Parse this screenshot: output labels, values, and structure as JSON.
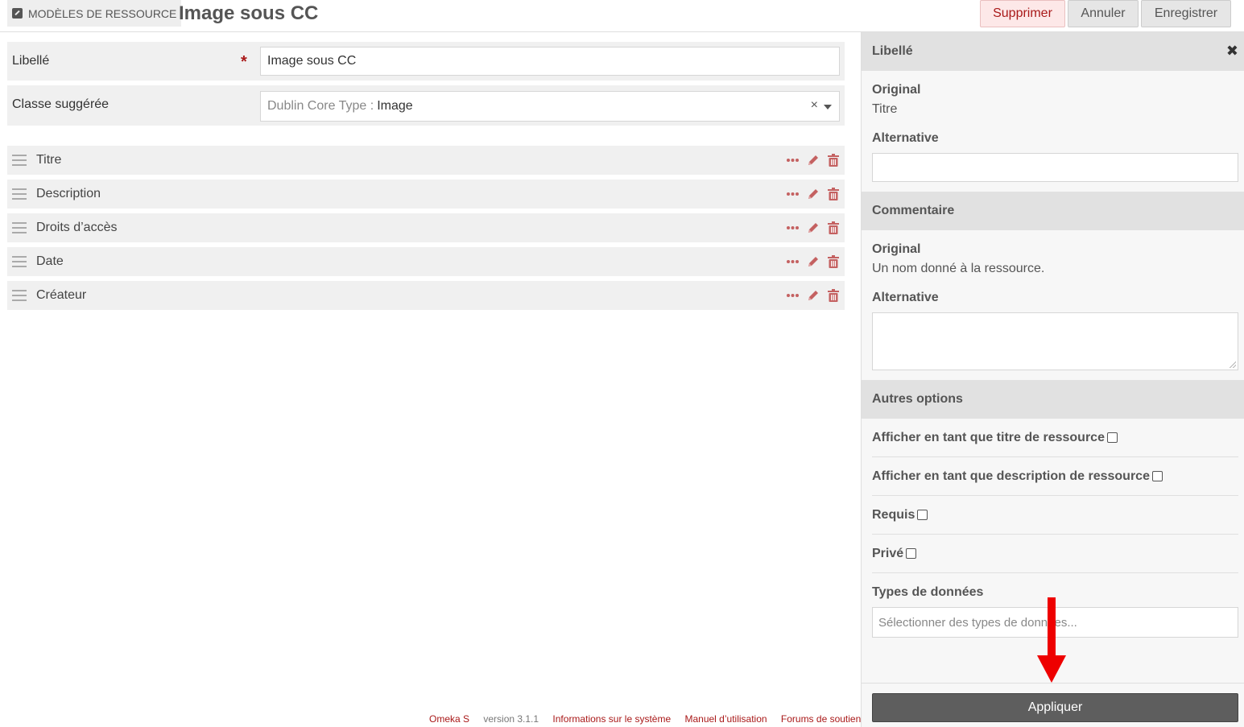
{
  "header": {
    "section": "MODÈLES DE RESSOURCE",
    "title": "Image sous CC",
    "buttons": {
      "delete": "Supprimer",
      "cancel": "Annuler",
      "save": "Enregistrer"
    }
  },
  "form": {
    "label_field": {
      "label": "Libellé",
      "required_mark": "*",
      "value": "Image sous CC"
    },
    "class_field": {
      "label": "Classe suggérée",
      "prefix": "Dublin Core Type :",
      "value": "Image",
      "clear": "×"
    }
  },
  "properties": [
    "Titre",
    "Description",
    "Droits d’accès",
    "Date",
    "Créateur"
  ],
  "footer": {
    "brand": "Omeka S",
    "version": "version 3.1.1",
    "links": [
      "Informations sur le système",
      "Manuel d’utilisation",
      "Forums de soutien"
    ]
  },
  "sidebar": {
    "label_section": {
      "title": "Libellé",
      "close": "✖",
      "original_label": "Original",
      "original_value": "Titre",
      "alternative_label": "Alternative",
      "alternative_value": ""
    },
    "comment_section": {
      "title": "Commentaire",
      "original_label": "Original",
      "original_value": "Un nom donné à la ressource.",
      "alternative_label": "Alternative",
      "alternative_value": ""
    },
    "options_section": {
      "title": "Autres options",
      "options": [
        {
          "label": "Afficher en tant que titre de ressource",
          "checked": false
        },
        {
          "label": "Afficher en tant que description de ressource",
          "checked": false
        },
        {
          "label": "Requis",
          "checked": false
        },
        {
          "label": "Privé",
          "checked": false
        }
      ],
      "data_types_label": "Types de données",
      "data_types_placeholder": "Sélectionner des types de données..."
    },
    "apply_button": "Appliquer"
  },
  "colors": {
    "accent": "#a91919",
    "annotation_arrow": "#ee0000"
  }
}
